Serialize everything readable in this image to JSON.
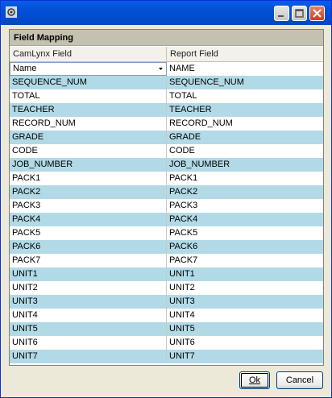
{
  "window": {
    "title": ""
  },
  "group": {
    "title": "Field Mapping"
  },
  "columns": {
    "left": "CamLynx Field",
    "right": "Report Field"
  },
  "first_row": {
    "dropdown_value": "Name",
    "report_field": "NAME"
  },
  "rows": [
    {
      "left": "SEQUENCE_NUM",
      "right": "SEQUENCE_NUM"
    },
    {
      "left": "TOTAL",
      "right": "TOTAL"
    },
    {
      "left": "TEACHER",
      "right": "TEACHER"
    },
    {
      "left": "RECORD_NUM",
      "right": "RECORD_NUM"
    },
    {
      "left": "GRADE",
      "right": "GRADE"
    },
    {
      "left": "CODE",
      "right": "CODE"
    },
    {
      "left": "JOB_NUMBER",
      "right": "JOB_NUMBER"
    },
    {
      "left": "PACK1",
      "right": "PACK1"
    },
    {
      "left": "PACK2",
      "right": "PACK2"
    },
    {
      "left": "PACK3",
      "right": "PACK3"
    },
    {
      "left": "PACK4",
      "right": "PACK4"
    },
    {
      "left": "PACK5",
      "right": "PACK5"
    },
    {
      "left": "PACK6",
      "right": "PACK6"
    },
    {
      "left": "PACK7",
      "right": "PACK7"
    },
    {
      "left": "UNIT1",
      "right": "UNIT1"
    },
    {
      "left": "UNIT2",
      "right": "UNIT2"
    },
    {
      "left": "UNIT3",
      "right": "UNIT3"
    },
    {
      "left": "UNIT4",
      "right": "UNIT4"
    },
    {
      "left": "UNIT5",
      "right": "UNIT5"
    },
    {
      "left": "UNIT6",
      "right": "UNIT6"
    },
    {
      "left": "UNIT7",
      "right": "UNIT7"
    }
  ],
  "buttons": {
    "ok": "Ok",
    "cancel": "Cancel"
  },
  "colors": {
    "alt_row": "#b2dae6",
    "titlebar": "#0050d7"
  }
}
